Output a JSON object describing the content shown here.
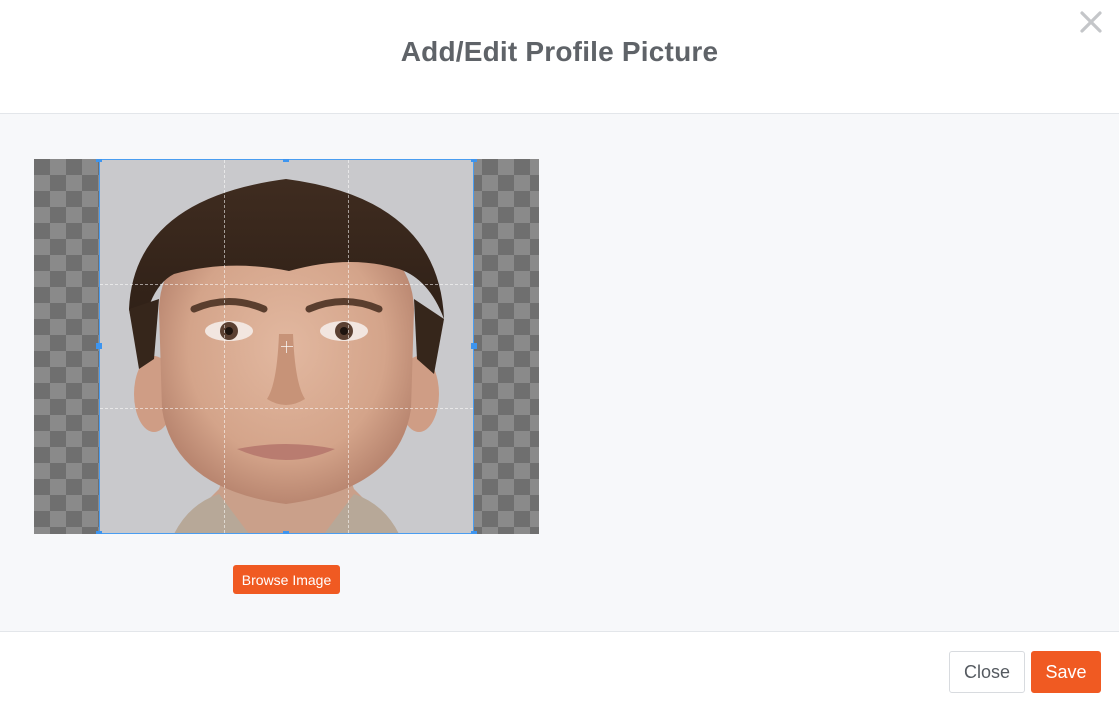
{
  "modal": {
    "title": "Add/Edit Profile Picture",
    "close_icon": "close-icon"
  },
  "cropper": {
    "guides": "3x3 dashed",
    "background": "transparency checkerboard"
  },
  "buttons": {
    "browse_label": "Browse Image",
    "close_label": "Close",
    "save_label": "Save"
  },
  "colors": {
    "accent": "#f05a22",
    "crop_border": "#4a9df0",
    "title": "#5f6368"
  }
}
